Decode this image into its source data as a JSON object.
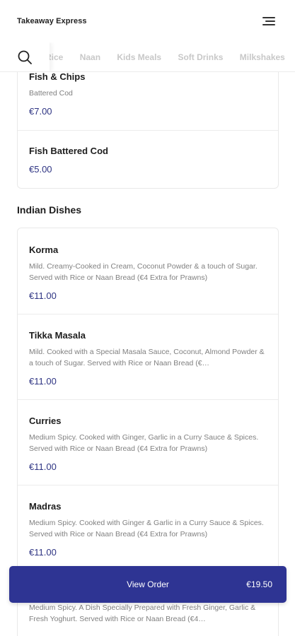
{
  "header": {
    "brand": "Takeaway Express",
    "menu_icon": "hamburger-menu-icon"
  },
  "category_bar": {
    "search_icon": "search-icon",
    "categories": [
      "Rice",
      "Naan",
      "Kids Meals",
      "Soft Drinks",
      "Milkshakes"
    ]
  },
  "fish_section": {
    "items": [
      {
        "name": "Fish & Chips",
        "description": "Battered Cod",
        "price": "€7.00"
      },
      {
        "name": "Fish Battered Cod",
        "description": "",
        "price": "€5.00"
      }
    ]
  },
  "indian_section": {
    "title": "Indian Dishes",
    "items": [
      {
        "name": "Korma",
        "description": "Mild. Creamy-Cooked in Cream, Coconut Powder & a touch of Sugar. Served with Rice or Naan Bread (€4 Extra for Prawns)",
        "price": "€11.00"
      },
      {
        "name": "Tikka Masala",
        "description": "Mild. Cooked with a Special Masala Sauce, Coconut, Almond Powder & a touch of Sugar. Served with Rice or Naan Bread (€…",
        "price": "€11.00"
      },
      {
        "name": "Curries",
        "description": "Medium Spicy. Cooked with Ginger, Garlic in a Curry Sauce & Spices. Served with Rice or Naan Bread (€4 Extra for Prawns)",
        "price": "€11.00"
      },
      {
        "name": "Madras",
        "description": "Medium Spicy. Cooked with Ginger & Garlic in a Curry Sauce & Spices. Served with Rice or Naan Bread (€4 Extra for Prawns)",
        "price": "€11.00"
      },
      {
        "name": "",
        "description": "Medium Spicy. A Dish Specially Prepared with Fresh Ginger, Garlic & Fresh Yoghurt. Served with Rice or Naan Bread (€4…",
        "price": ""
      }
    ]
  },
  "order_bar": {
    "label": "View Order",
    "total": "€19.50"
  },
  "colors": {
    "accent": "#2e3493",
    "price": "#2e3483"
  }
}
